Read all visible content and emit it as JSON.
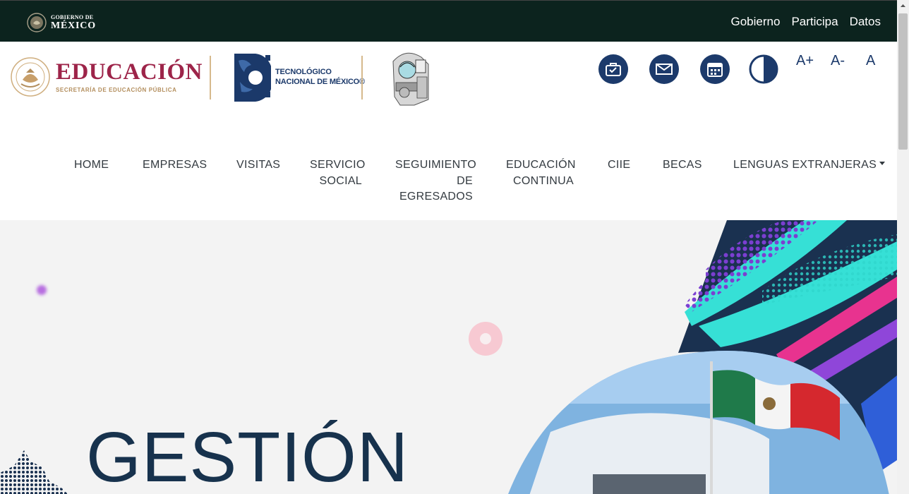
{
  "gov_bar": {
    "logo_line1": "GOBIERNO DE",
    "logo_line2": "MÉXICO",
    "links": [
      "Gobierno",
      "Participa",
      "Datos"
    ]
  },
  "header": {
    "edu_title": "EDUCACIÓN",
    "edu_subtitle": "SECRETARÍA DE EDUCACIÓN PÚBLICA",
    "tec_line1": "TECNOLÓGICO",
    "tec_line2": "NACIONAL DE MÉXICO®",
    "font_controls": [
      "A+",
      "A-",
      "A"
    ],
    "tool_icons": [
      "mailbox-icon",
      "envelope-icon",
      "calendar-icon",
      "contrast-icon"
    ]
  },
  "nav": {
    "items": [
      {
        "label": "HOME"
      },
      {
        "label": "EMPRESAS"
      },
      {
        "label": "VISITAS"
      },
      {
        "label": "SERVICIO SOCIAL"
      },
      {
        "label": "SEGUIMIENTO DE EGRESADOS"
      },
      {
        "label": "EDUCACIÓN CONTINUA"
      },
      {
        "label": "CIIE"
      },
      {
        "label": "BECAS"
      },
      {
        "label": "LENGUAS EXTRANJERAS"
      }
    ]
  },
  "hero": {
    "title": "GESTIÓN"
  },
  "colors": {
    "gov_bar": "#0c231e",
    "edu_red": "#9d2449",
    "gold": "#b38e5d",
    "tec_blue": "#1b396a",
    "hero_bg": "#f3f3f3",
    "hero_title": "#17324d"
  }
}
